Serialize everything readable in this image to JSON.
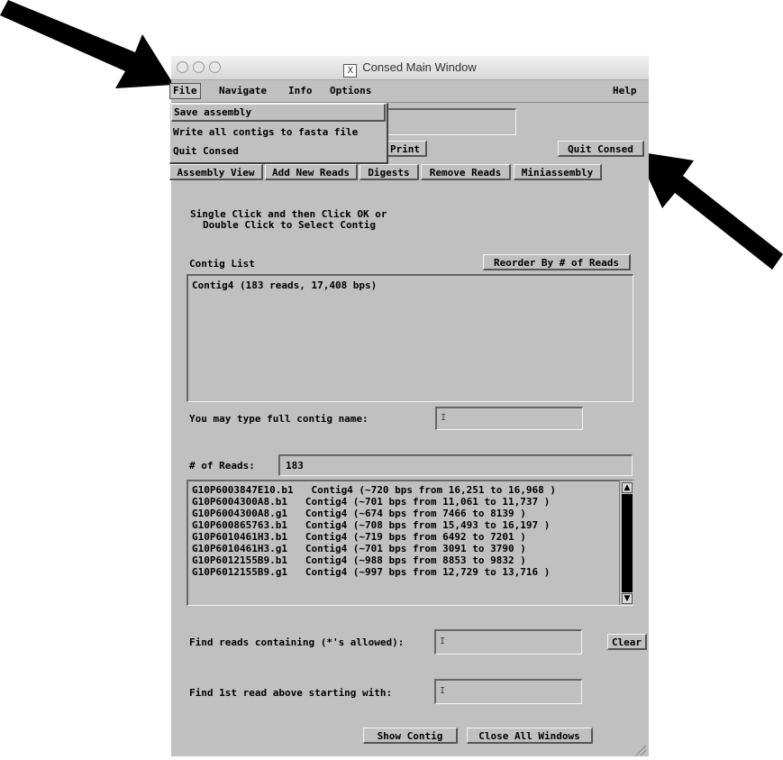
{
  "window": {
    "title": "Consed Main Window",
    "title_icon": "x11-icon"
  },
  "menubar": {
    "file": "File",
    "navigate": "Navigate",
    "info": "Info",
    "options": "Options",
    "help": "Help"
  },
  "file_menu": {
    "items": [
      "Save assembly",
      "Write all contigs to fasta file",
      "Quit Consed"
    ]
  },
  "toolbar": {
    "print": "Print",
    "quit": "Quit Consed"
  },
  "tabs": [
    "Assembly View",
    "Add New Reads",
    "Digests",
    "Remove Reads",
    "Miniassembly"
  ],
  "instructions": {
    "line1": "Single Click and then Click OK or",
    "line2": "Double Click to Select Contig"
  },
  "contig_list": {
    "label": "Contig List",
    "reorder_button": "Reorder By # of Reads",
    "items": [
      "Contig4 (183 reads, 17,408 bps)"
    ]
  },
  "contig_name": {
    "label": "You may type full contig name:",
    "value": ""
  },
  "reads": {
    "count_label": "# of Reads:",
    "count_value": "183",
    "rows": [
      "G10P6003847E10.b1   Contig4 (~720 bps from 16,251 to 16,968 )",
      "G10P6004300A8.b1   Contig4 (~701 bps from 11,061 to 11,737 )",
      "G10P6004300A8.g1   Contig4 (~674 bps from 7466 to 8139 )",
      "G10P600865763.b1   Contig4 (~708 bps from 15,493 to 16,197 )",
      "G10P6010461H3.b1   Contig4 (~719 bps from 6492 to 7201 )",
      "G10P6010461H3.g1   Contig4 (~701 bps from 3091 to 3790 )",
      "G10P6012155B9.b1   Contig4 (~988 bps from 8853 to 9832 )",
      "G10P6012155B9.g1   Contig4 (~997 bps from 12,729 to 13,716 )"
    ]
  },
  "find_reads": {
    "label": "Find reads containing (*'s allowed):",
    "value": "",
    "clear_button": "Clear"
  },
  "find_first": {
    "label": "Find 1st read above starting with:",
    "value": ""
  },
  "bottom": {
    "show_contig": "Show Contig",
    "close_all": "Close All Windows"
  },
  "colors": {
    "window_bg": "#c0c0c0",
    "arrow": "#000000"
  }
}
